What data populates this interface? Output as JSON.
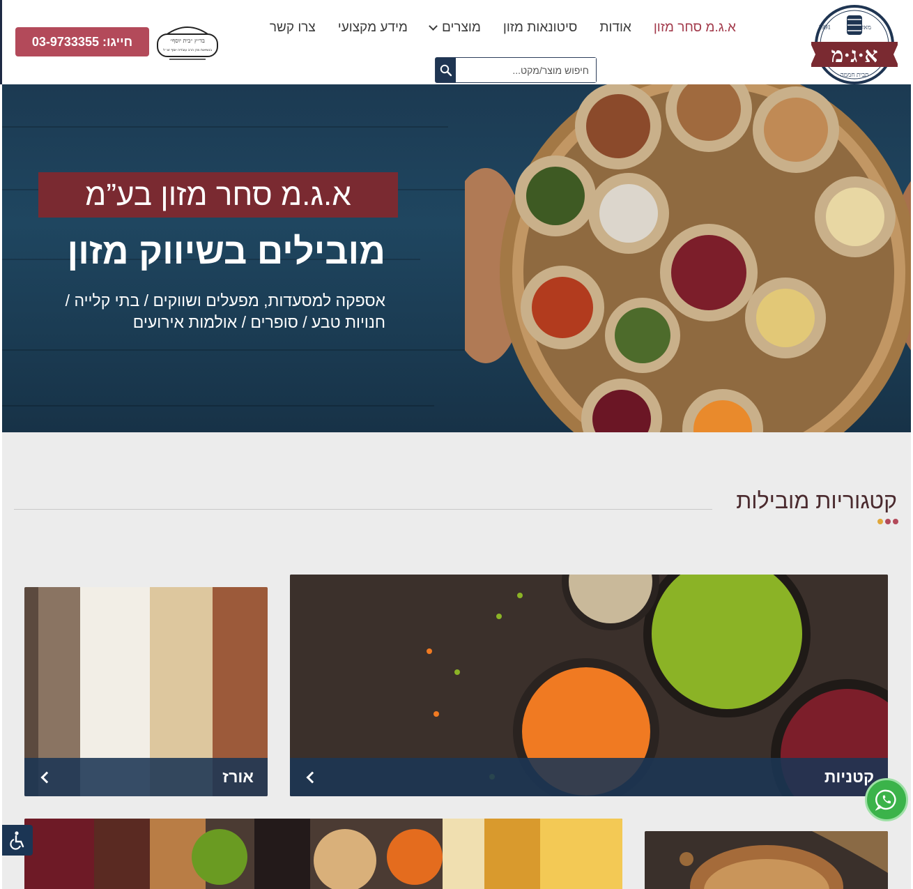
{
  "header": {
    "logo": {
      "name": "א·ג·מ",
      "est_label": "מאז",
      "year": "1991",
      "tagline": "תבית חממה"
    },
    "nav": [
      {
        "label": "א.ג.מ סחר מזון",
        "active": true
      },
      {
        "label": "אודות"
      },
      {
        "label": "סיטונאות מזון"
      },
      {
        "label": "מוצרים",
        "has_dropdown": true
      },
      {
        "label": "מידע מקצועי"
      },
      {
        "label": "צרו קשר"
      }
    ],
    "search": {
      "placeholder": "חיפוש מוצר/מקט...",
      "icon": "search-icon"
    },
    "kosher": {
      "line1": "בד״ץ ״בית יוסף״",
      "line2": "בנשיאות מרן הרב עובדיה יוסף זצ״ל",
      "icon": "kosher-certificate-icon"
    },
    "phone": {
      "label": "חייגו: 03-9733355"
    }
  },
  "hero": {
    "title": "א.ג.מ סחר מזון בע”מ",
    "subtitle": "מובילים בשיווק מזון",
    "description": "אספקה למסעדות, מפעלים ושווקים / בתי קלייה / חנויות טבע / סופרים / אולמות אירועים"
  },
  "categories": {
    "title": "קטגוריות מובילות",
    "dot_colors": [
      "#b34a5a",
      "#b34a5a",
      "#e0a83b"
    ],
    "items": [
      {
        "label": "קטניות",
        "image": "legumes-bowls"
      },
      {
        "label": "אורז",
        "image": "rice-varieties"
      },
      {
        "label": "",
        "image": "dried-fruits"
      },
      {
        "label": "",
        "image": "mixed-nuts"
      }
    ]
  },
  "floating": {
    "whatsapp_icon": "whatsapp-icon",
    "accessibility_icon": "accessibility-icon"
  },
  "colors": {
    "accent": "#b34a5a",
    "navy": "#1f3552",
    "hero_title_bg": "#7a2a31"
  }
}
